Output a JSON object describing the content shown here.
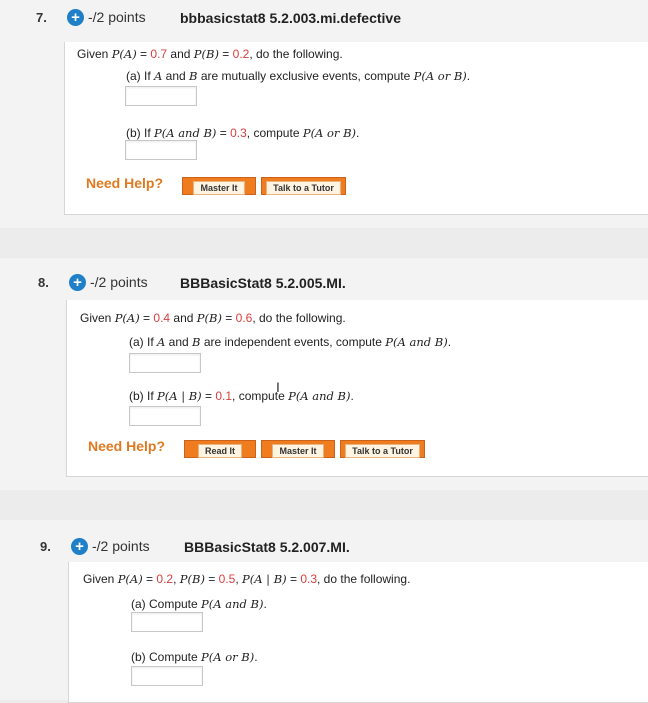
{
  "questions": [
    {
      "number": "7.",
      "points": "-/2 points",
      "id": "bbbasicstat8 5.2.003.mi.defective",
      "given": {
        "prefix": "Given ",
        "pa_label": "P(A)",
        "pa_eq": " = ",
        "pa_val": "0.7",
        "and": " and ",
        "pb_label": "P(B)",
        "pb_eq": " = ",
        "pb_val": "0.2",
        "suffix": ", do the following."
      },
      "part_a": {
        "pre": "(a) If ",
        "v1": "A",
        "mid": " and ",
        "v2": "B",
        "post": " are mutually exclusive events, compute ",
        "expr": "P(A or B)",
        "end": "."
      },
      "part_b": {
        "pre": "(b) If ",
        "expr1": "P(A and B)",
        "eq": " = ",
        "val": "0.3",
        "post": ", compute ",
        "expr2": "P(A or B)",
        "end": "."
      },
      "need_help": "Need Help?",
      "buttons": [
        "Master It",
        "Talk to a Tutor"
      ]
    },
    {
      "number": "8.",
      "points": "-/2 points",
      "id": "BBBasicStat8 5.2.005.MI.",
      "given": {
        "prefix": "Given ",
        "pa_label": "P(A)",
        "pa_eq": " = ",
        "pa_val": "0.4",
        "and": " and ",
        "pb_label": "P(B)",
        "pb_eq": " = ",
        "pb_val": "0.6",
        "suffix": ", do the following."
      },
      "part_a": {
        "pre": "(a) If ",
        "v1": "A",
        "mid": " and ",
        "v2": "B",
        "post": " are independent events, compute ",
        "expr": "P(A and B)",
        "end": "."
      },
      "part_b": {
        "pre": "(b) If ",
        "expr1": "P(A | B)",
        "eq": " = ",
        "val": "0.1",
        "post": ", compute ",
        "expr2": "P(A and B)",
        "end": "."
      },
      "need_help": "Need Help?",
      "buttons": [
        "Read It",
        "Master It",
        "Talk to a Tutor"
      ]
    },
    {
      "number": "9.",
      "points": "-/2 points",
      "id": "BBBasicStat8 5.2.007.MI.",
      "given": {
        "prefix": "Given ",
        "pa_label": "P(A)",
        "pa_eq": " = ",
        "pa_val": "0.2",
        "sep1": ", ",
        "pb_label": "P(B)",
        "pb_eq": " = ",
        "pb_val": "0.5",
        "sep2": ", ",
        "pab_label": "P(A | B)",
        "pab_eq": " = ",
        "pab_val": "0.3",
        "suffix": ", do the following."
      },
      "part_a": {
        "pre": "(a) Compute ",
        "expr": "P(A and B)",
        "end": "."
      },
      "part_b": {
        "pre": "(b) Compute ",
        "expr": "P(A or B)",
        "end": "."
      }
    }
  ],
  "colors": {
    "accent_blue": "#1f7fc9",
    "help_orange": "#e07a20",
    "value_red": "#d94040"
  },
  "icons": {
    "points_badge": "plus-circle-icon",
    "text_cursor": "i-beam-cursor-icon"
  }
}
